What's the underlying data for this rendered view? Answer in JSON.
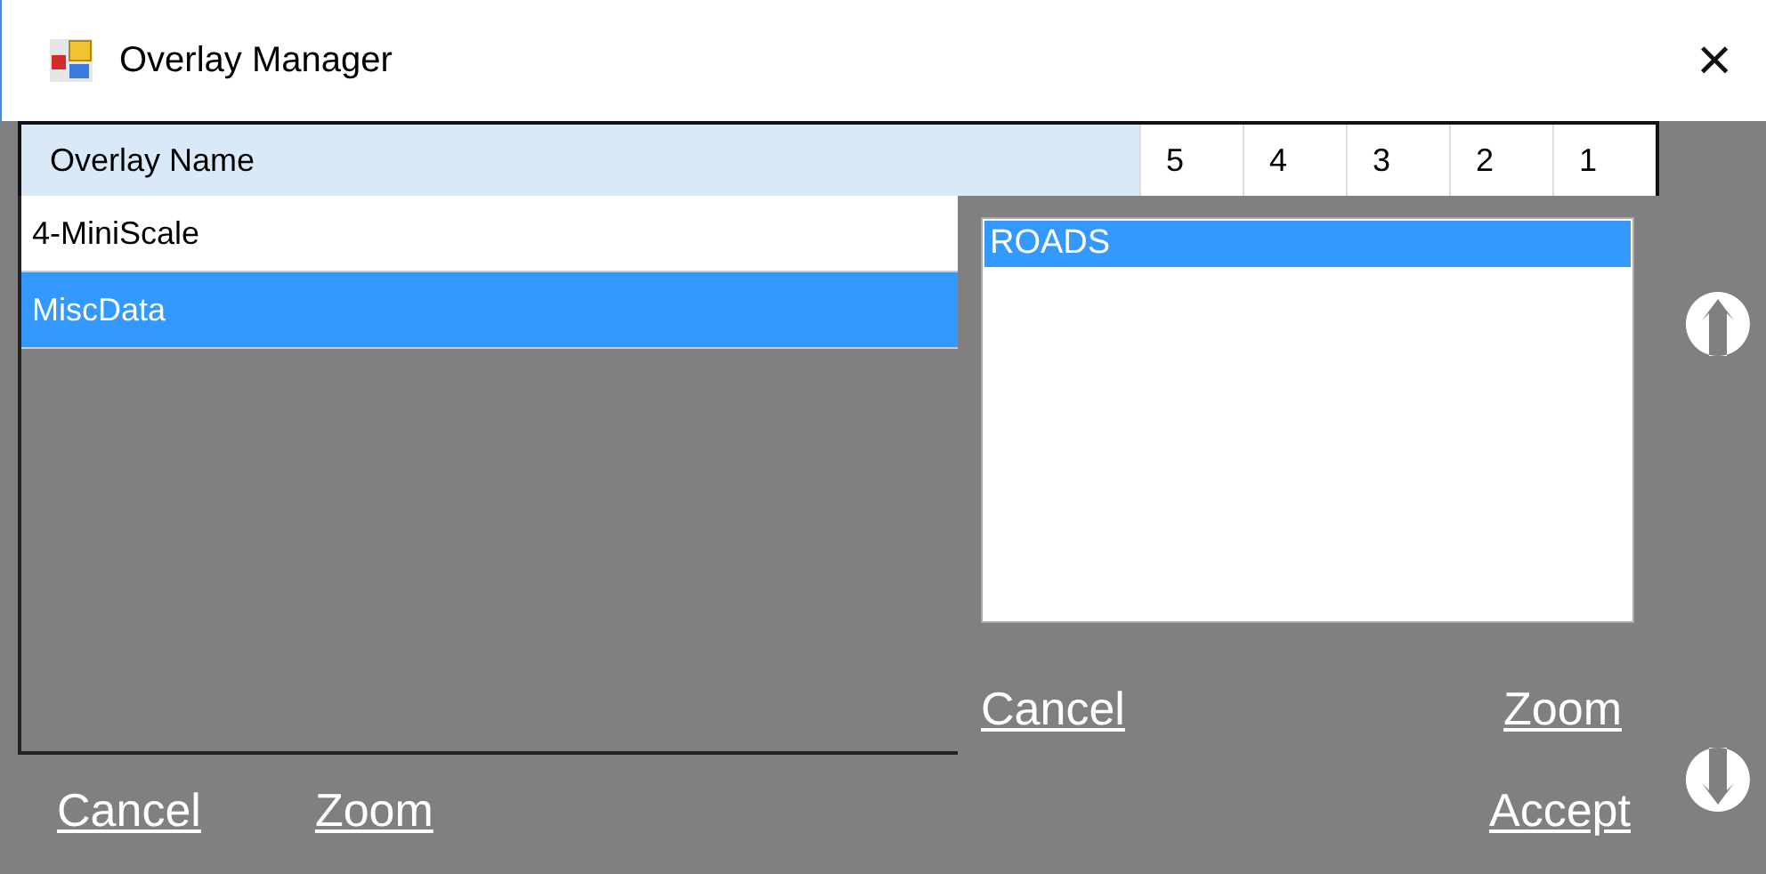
{
  "window": {
    "title": "Overlay Manager",
    "close": "×"
  },
  "grid": {
    "columns": [
      "Overlay Name",
      "5",
      "4",
      "3",
      "2",
      "1"
    ],
    "rows": [
      {
        "name": "4-MiniScale",
        "selected": false
      },
      {
        "name": "MiscData",
        "selected": true
      }
    ]
  },
  "layers": {
    "items": [
      {
        "name": "ROADS",
        "selected": true
      }
    ],
    "links": [
      "Cancel",
      "Zoom"
    ]
  },
  "footer": {
    "links": [
      "Cancel",
      "Zoom"
    ],
    "accept": "Accept"
  }
}
